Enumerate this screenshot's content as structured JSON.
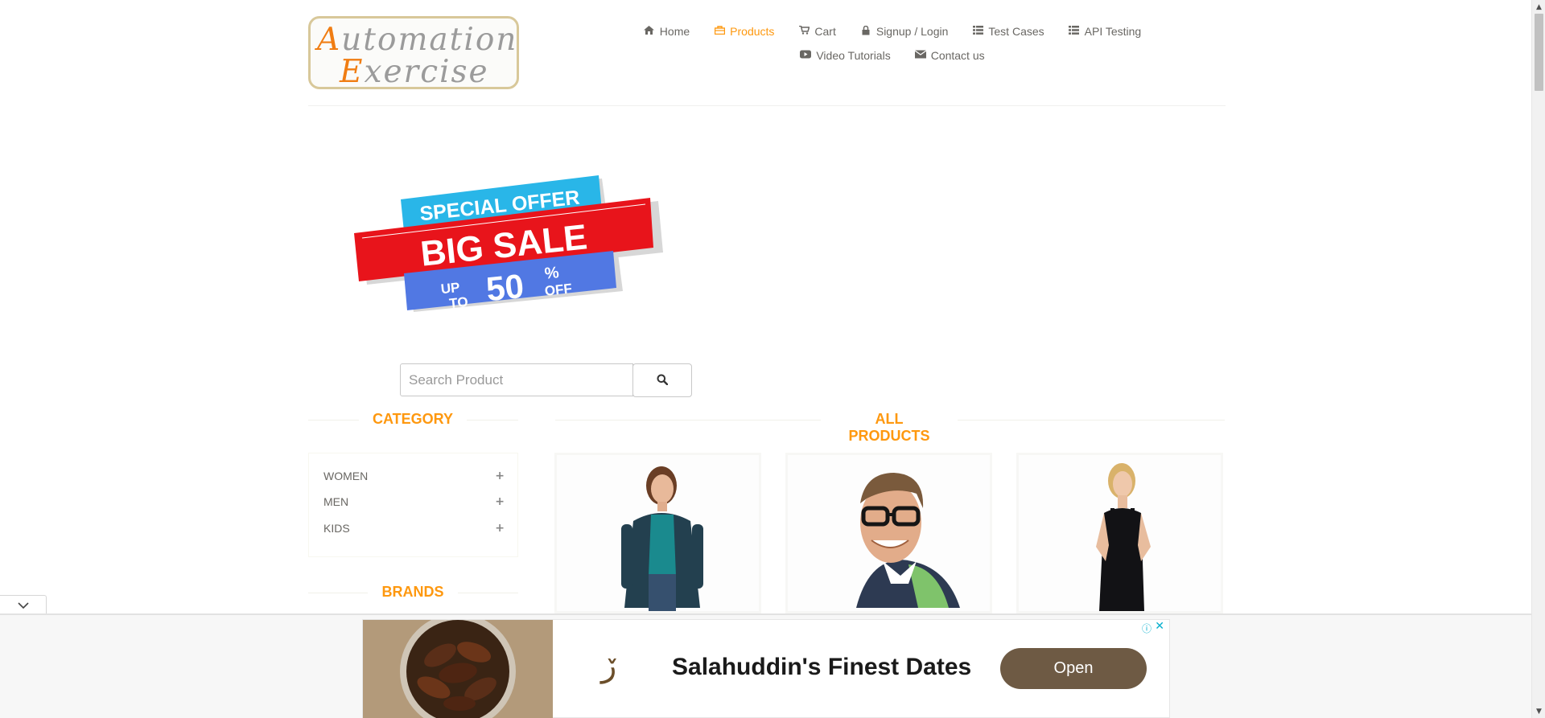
{
  "header": {
    "logo_text_line1": "Automation",
    "logo_text_line2": "Exercise",
    "nav": {
      "row1": [
        {
          "label": "Home",
          "icon": "home-icon",
          "active": false
        },
        {
          "label": "Products",
          "icon": "shopping-bag-icon",
          "active": true
        },
        {
          "label": "Cart",
          "icon": "cart-icon",
          "active": false
        },
        {
          "label": "Signup / Login",
          "icon": "lock-icon",
          "active": false
        },
        {
          "label": "Test Cases",
          "icon": "list-icon",
          "active": false
        },
        {
          "label": "API Testing",
          "icon": "list-icon",
          "active": false
        }
      ],
      "row2": [
        {
          "label": "Video Tutorials",
          "icon": "youtube-icon",
          "active": false
        },
        {
          "label": "Contact us",
          "icon": "envelope-icon",
          "active": false
        }
      ]
    },
    "active_color": "#fe980f"
  },
  "banner": {
    "line1": "SPECIAL OFFER",
    "line2": "BIG SALE",
    "line3_prefix_top": "UP",
    "line3_prefix_bottom": "TO",
    "line3_value": "50",
    "line3_suffix_top": "%",
    "line3_suffix_bottom": "OFF"
  },
  "search": {
    "placeholder": "Search Product",
    "value": ""
  },
  "sidebar": {
    "category_title": "CATEGORY",
    "categories": [
      "WOMEN",
      "MEN",
      "KIDS"
    ],
    "brands_title": "BRANDS"
  },
  "main": {
    "title": "ALL PRODUCTS"
  },
  "ad": {
    "mark": "ڒ",
    "headline": "Salahuddin's Finest Dates",
    "button_label": "Open",
    "button_color": "#6e5a44"
  }
}
